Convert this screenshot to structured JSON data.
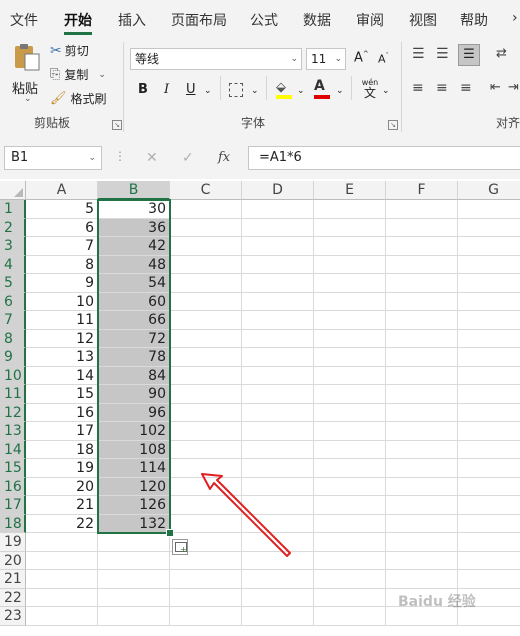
{
  "tabs": [
    "文件",
    "开始",
    "插入",
    "页面布局",
    "公式",
    "数据",
    "审阅",
    "视图",
    "帮助"
  ],
  "clipboard": {
    "paste": "粘贴",
    "cut": "剪切",
    "copy": "复制",
    "format_painter": "格式刷",
    "label": "剪贴板"
  },
  "font": {
    "name": "等线",
    "size": "11",
    "bold": "B",
    "italic": "I",
    "underline": "U",
    "phonetic": "wén",
    "phonetic_sub": "文",
    "label": "字体"
  },
  "align": {
    "label": "对齐"
  },
  "namebox": "B1",
  "fx": "fx",
  "formula": "=A1*6",
  "columns": [
    "A",
    "B",
    "C",
    "D",
    "E",
    "F",
    "G"
  ],
  "rows": [
    "1",
    "2",
    "3",
    "4",
    "5",
    "6",
    "7",
    "8",
    "9",
    "10",
    "11",
    "12",
    "13",
    "14",
    "15",
    "16",
    "17",
    "18",
    "19",
    "20",
    "21",
    "22",
    "23"
  ],
  "col_a": [
    "5",
    "6",
    "7",
    "8",
    "9",
    "10",
    "11",
    "12",
    "13",
    "14",
    "15",
    "16",
    "17",
    "18",
    "19",
    "20",
    "21",
    "22"
  ],
  "col_b": [
    "30",
    "36",
    "42",
    "48",
    "54",
    "60",
    "66",
    "72",
    "78",
    "84",
    "90",
    "96",
    "102",
    "108",
    "114",
    "120",
    "126",
    "132"
  ],
  "watermark": "Baidu 经验",
  "colors": {
    "accent": "#217346",
    "font_color": "#e00000",
    "highlight": "#ffff00",
    "arrow": "#e02020"
  }
}
